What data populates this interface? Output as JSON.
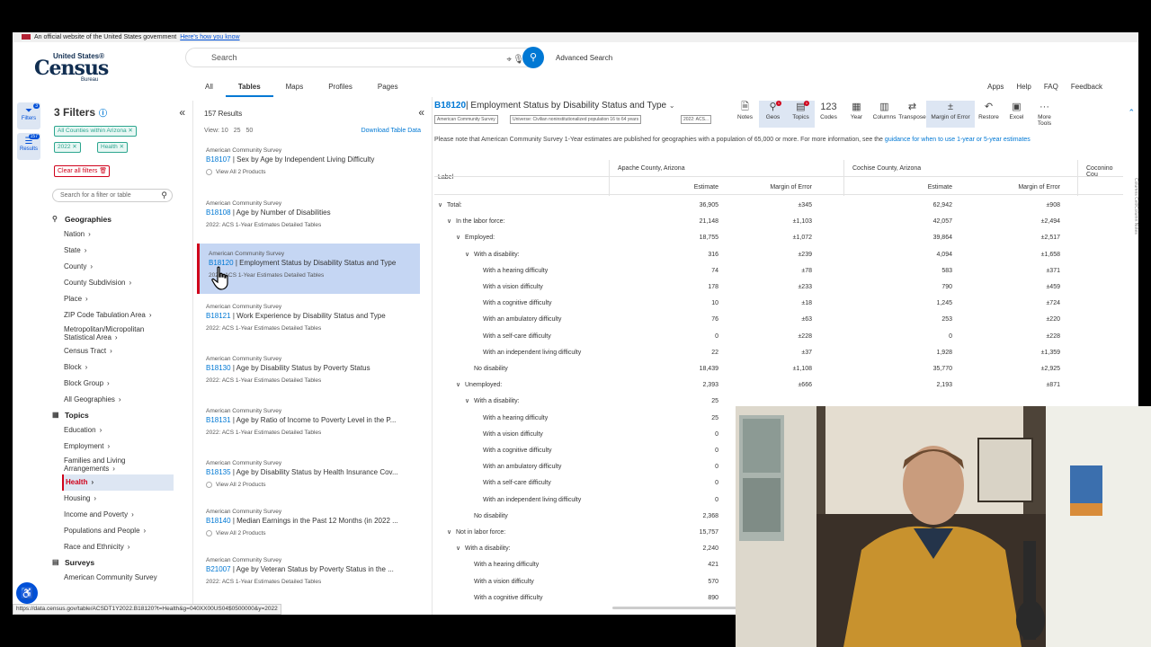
{
  "govbar": {
    "text": "An official website of the United States government",
    "link": "Here's how you know"
  },
  "logo": {
    "top": "United States®",
    "main": "Census",
    "bureau": "Bureau"
  },
  "search": {
    "placeholder": "Search",
    "advanced": "Advanced Search"
  },
  "navtabs": [
    "All",
    "Tables",
    "Maps",
    "Profiles",
    "Pages"
  ],
  "toplinks": [
    "Apps",
    "Help",
    "FAQ",
    "Feedback"
  ],
  "rail": {
    "filters_label": "Filters",
    "filters_badge": "3",
    "results_label": "Results",
    "results_badge": "157"
  },
  "filters": {
    "title": "3 Filters",
    "chips": [
      "All Counties within Arizona",
      "2022",
      "Health"
    ],
    "clear_all": "Clear all filters",
    "search_placeholder": "Search for a filter or table",
    "geographies_heading": "Geographies",
    "geographies": [
      "Nation",
      "State",
      "County",
      "County Subdivision",
      "Place",
      "ZIP Code Tabulation Area",
      "Metropolitan/Micropolitan Statistical Area",
      "Census Tract",
      "Block",
      "Block Group",
      "All Geographies"
    ],
    "topics_heading": "Topics",
    "topics": [
      "Education",
      "Employment",
      "Families and Living Arrangements",
      "Health",
      "Housing",
      "Income and Poverty",
      "Populations and People",
      "Race and Ethnicity"
    ],
    "surveys_heading": "Surveys",
    "surveys": [
      "American Community Survey"
    ]
  },
  "results": {
    "count": "157 Results",
    "view_label": "View: 10",
    "view_opts": [
      "25",
      "50"
    ],
    "download": "Download Table Data",
    "items": [
      {
        "survey": "American Community Survey",
        "code": "B18107",
        "title": " | Sex by Age by Independent Living Difficulty",
        "sub": "View All 2 Products",
        "plus": true
      },
      {
        "survey": "American Community Survey",
        "code": "B18108",
        "title": " | Age by Number of Disabilities",
        "sub": "2022: ACS 1-Year Estimates Detailed Tables",
        "plus": false
      },
      {
        "survey": "American Community Survey",
        "code": "B18120",
        "title": " | Employment Status by Disability Status and Type",
        "sub": "2022: ACS 1-Year Estimates Detailed Tables",
        "plus": false
      },
      {
        "survey": "American Community Survey",
        "code": "B18121",
        "title": " | Work Experience by Disability Status and Type",
        "sub": "2022: ACS 1-Year Estimates Detailed Tables",
        "plus": false
      },
      {
        "survey": "American Community Survey",
        "code": "B18130",
        "title": " | Age by Disability Status by Poverty Status",
        "sub": "2022: ACS 1-Year Estimates Detailed Tables",
        "plus": false
      },
      {
        "survey": "American Community Survey",
        "code": "B18131",
        "title": " | Age by Ratio of Income to Poverty Level in the P...",
        "sub": "2022: ACS 1-Year Estimates Detailed Tables",
        "plus": false
      },
      {
        "survey": "American Community Survey",
        "code": "B18135",
        "title": " | Age by Disability Status by Health Insurance Cov...",
        "sub": "View All 2 Products",
        "plus": true
      },
      {
        "survey": "American Community Survey",
        "code": "B18140",
        "title": " | Median Earnings in the Past 12 Months (in 2022 ...",
        "sub": "View All 2 Products",
        "plus": true
      },
      {
        "survey": "American Community Survey",
        "code": "B21007",
        "title": " | Age by Veteran Status by Poverty Status in the ...",
        "sub": "2022: ACS 1-Year Estimates Detailed Tables",
        "plus": false
      }
    ]
  },
  "table": {
    "code": "B18120",
    "title": "| Employment Status by Disability Status and Type",
    "chips": [
      "American Community Survey",
      "Universe: Civilian noninstitutionalized population 16 to 64 years",
      "2022: ACS..."
    ],
    "tools": [
      {
        "label": "Notes",
        "icon": "🗎"
      },
      {
        "label": "Geos",
        "icon": "⚲",
        "badge": "1",
        "hi": true
      },
      {
        "label": "Topics",
        "icon": "▤",
        "badge": "1",
        "hi": true
      },
      {
        "label": "Codes",
        "icon": "123"
      },
      {
        "label": "Year",
        "icon": "▦"
      },
      {
        "label": "Columns",
        "icon": "▥"
      },
      {
        "label": "Transpose",
        "icon": "⇄"
      },
      {
        "label": "Margin of Error",
        "icon": "±",
        "hi": true
      },
      {
        "label": "Restore",
        "icon": "↶"
      },
      {
        "label": "Excel",
        "icon": "▣"
      },
      {
        "label": "More Tools",
        "icon": "···"
      }
    ],
    "notice": "Please note that American Community Survey 1-Year estimates are published for geographies with a population of 65,000 or more. For more information, see the",
    "notice_link": "guidance for when to use 1-year or 5-year estimates",
    "label_header": "Label",
    "geos": [
      "Apache County, Arizona",
      "Cochise County, Arizona",
      "Coconino Cou"
    ],
    "col_headers": [
      "Estimate",
      "Margin of Error",
      "Estimate",
      "Margin of Error"
    ],
    "rows": [
      {
        "label": "Total:",
        "indent": 0,
        "toggle": "∨",
        "v": [
          "36,905",
          "±345",
          "62,942",
          "±908"
        ]
      },
      {
        "label": "In the labor force:",
        "indent": 1,
        "toggle": "∨",
        "v": [
          "21,148",
          "±1,103",
          "42,057",
          "±2,494"
        ]
      },
      {
        "label": "Employed:",
        "indent": 2,
        "toggle": "∨",
        "v": [
          "18,755",
          "±1,072",
          "39,864",
          "±2,517"
        ]
      },
      {
        "label": "With a disability:",
        "indent": 3,
        "toggle": "∨",
        "v": [
          "316",
          "±239",
          "4,094",
          "±1,658"
        ]
      },
      {
        "label": "With a hearing difficulty",
        "indent": 4,
        "toggle": "",
        "v": [
          "74",
          "±78",
          "583",
          "±371"
        ]
      },
      {
        "label": "With a vision difficulty",
        "indent": 4,
        "toggle": "",
        "v": [
          "178",
          "±233",
          "790",
          "±459"
        ]
      },
      {
        "label": "With a cognitive difficulty",
        "indent": 4,
        "toggle": "",
        "v": [
          "10",
          "±18",
          "1,245",
          "±724"
        ]
      },
      {
        "label": "With an ambulatory difficulty",
        "indent": 4,
        "toggle": "",
        "v": [
          "76",
          "±63",
          "253",
          "±220"
        ]
      },
      {
        "label": "With a self-care difficulty",
        "indent": 4,
        "toggle": "",
        "v": [
          "0",
          "±228",
          "0",
          "±228"
        ]
      },
      {
        "label": "With an independent living difficulty",
        "indent": 4,
        "toggle": "",
        "v": [
          "22",
          "±37",
          "1,928",
          "±1,359"
        ]
      },
      {
        "label": "No disability",
        "indent": 3,
        "toggle": "",
        "v": [
          "18,439",
          "±1,108",
          "35,770",
          "±2,925"
        ]
      },
      {
        "label": "Unemployed:",
        "indent": 2,
        "toggle": "∨",
        "v": [
          "2,393",
          "±666",
          "2,193",
          "±871"
        ]
      },
      {
        "label": "With a disability:",
        "indent": 3,
        "toggle": "∨",
        "v": [
          "25",
          "",
          "",
          ""
        ]
      },
      {
        "label": "With a hearing difficulty",
        "indent": 4,
        "toggle": "",
        "v": [
          "25",
          "",
          "",
          ""
        ]
      },
      {
        "label": "With a vision difficulty",
        "indent": 4,
        "toggle": "",
        "v": [
          "0",
          "",
          "",
          ""
        ]
      },
      {
        "label": "With a cognitive difficulty",
        "indent": 4,
        "toggle": "",
        "v": [
          "0",
          "",
          "",
          ""
        ]
      },
      {
        "label": "With an ambulatory difficulty",
        "indent": 4,
        "toggle": "",
        "v": [
          "0",
          "",
          "",
          ""
        ]
      },
      {
        "label": "With a self-care difficulty",
        "indent": 4,
        "toggle": "",
        "v": [
          "0",
          "",
          "",
          ""
        ]
      },
      {
        "label": "With an independent living difficulty",
        "indent": 4,
        "toggle": "",
        "v": [
          "0",
          "",
          "",
          ""
        ]
      },
      {
        "label": "No disability",
        "indent": 3,
        "toggle": "",
        "v": [
          "2,368",
          "",
          "",
          ""
        ]
      },
      {
        "label": "Not in labor force:",
        "indent": 1,
        "toggle": "∨",
        "v": [
          "15,757",
          "",
          "",
          ""
        ]
      },
      {
        "label": "With a disability:",
        "indent": 2,
        "toggle": "∨",
        "v": [
          "2,240",
          "",
          "",
          ""
        ]
      },
      {
        "label": "With a hearing difficulty",
        "indent": 3,
        "toggle": "",
        "v": [
          "421",
          "",
          "",
          ""
        ]
      },
      {
        "label": "With a vision difficulty",
        "indent": 3,
        "toggle": "",
        "v": [
          "570",
          "",
          "",
          ""
        ]
      },
      {
        "label": "With a cognitive difficulty",
        "indent": 3,
        "toggle": "",
        "v": [
          "890",
          "",
          "",
          ""
        ]
      }
    ],
    "side_tabs": "Columns  Cell/Column Notes"
  },
  "status_url": "https://data.census.gov/table/ACSDT1Y2022.B18120?t=Health&g=040XX00US04$0500000&y=2022"
}
